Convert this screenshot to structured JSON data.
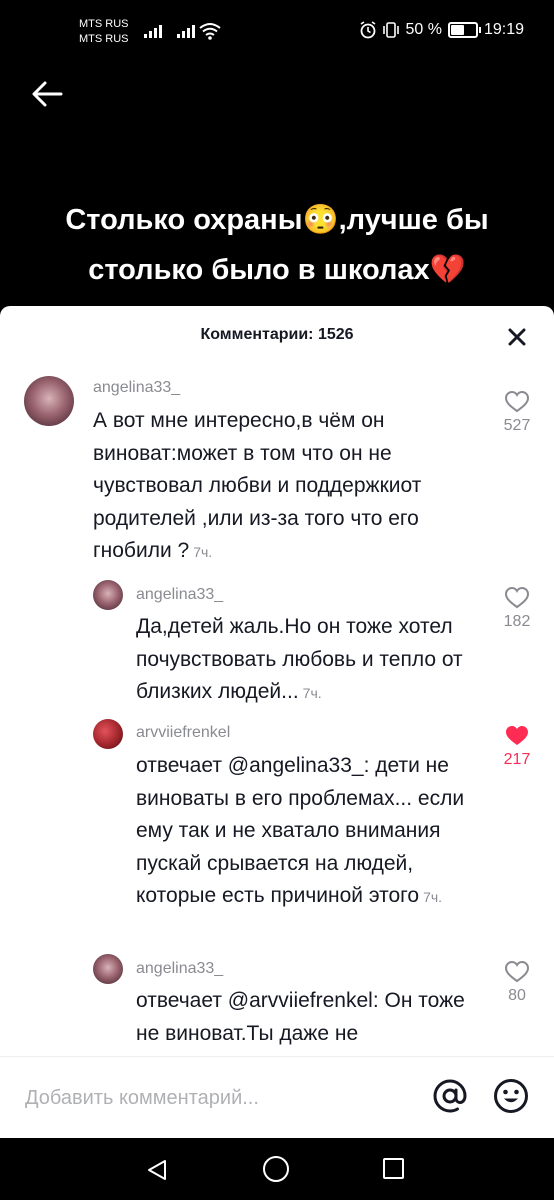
{
  "status_bar": {
    "carrier1": "MTS RUS",
    "carrier2": "MTS RUS",
    "battery": "50 %",
    "time": "19:19",
    "battery_level": 0.5
  },
  "video": {
    "caption_line1": "Столько охраны😳,лучше бы",
    "caption_line2": "столько было в школах💔"
  },
  "sheet": {
    "title": "Комментарии: 1526"
  },
  "comments": [
    {
      "username": "angelina33_",
      "text": "А вот мне интересно,в чём он виноват:может в том что он не чувствовал любви и поддержкиот родителей ,или из-за того что его гнобили ?",
      "time": "7ч.",
      "likes": "527",
      "liked": false
    },
    {
      "username": "angelina33_",
      "text": "Да,детей жаль.Но он тоже хотел почувствовать любовь и тепло от близких людей...",
      "time": "7ч.",
      "likes": "182",
      "liked": false
    },
    {
      "username": "arvviiefrenkel",
      "prefix": "отвечает ",
      "mention": "@angelina33_",
      "text": ": дети не виноваты в его проблемах... если ему так и не хватало внимания пускай срывается на людей, которые есть причиной этого",
      "time": "7ч.",
      "likes": "217",
      "liked": true
    },
    {
      "username": "angelina33_",
      "prefix": "отвечает ",
      "mention": "@arvviiefrenkel",
      "text": ": Он тоже не виноват.Ты даже не",
      "likes": "80",
      "liked": false
    }
  ],
  "input": {
    "placeholder": "Добавить комментарий..."
  },
  "colors": {
    "accent": "#fe2c55",
    "muted": "#8a8b91",
    "text": "#161823"
  }
}
